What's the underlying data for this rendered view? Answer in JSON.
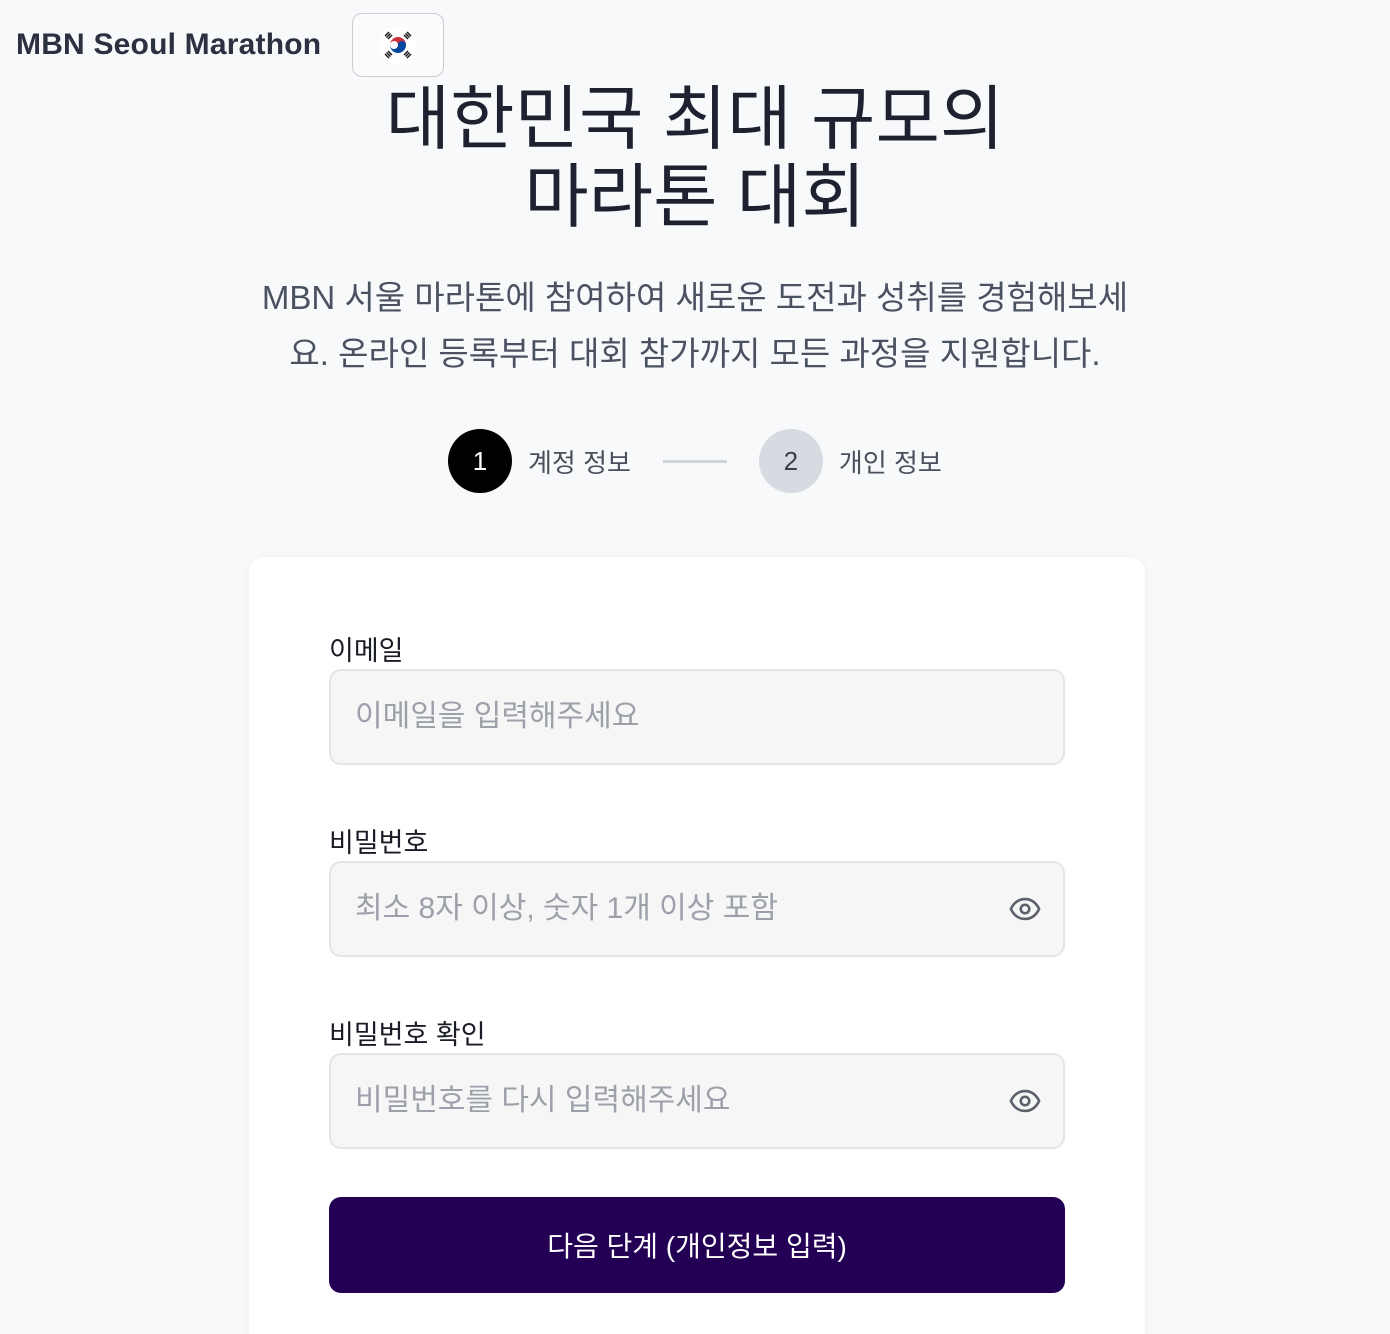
{
  "header": {
    "brand": "MBN Seoul Marathon",
    "language_icon": "south-korea-flag-icon"
  },
  "hero": {
    "title_line1": "대한민국 최대 규모의",
    "title_line2": "마라톤 대회",
    "subtitle": "MBN 서울 마라톤에 참여하여 새로운 도전과 성취를 경험해보세요. 온라인 등록부터 대회 참가까지 모든 과정을 지원합니다."
  },
  "stepper": {
    "steps": [
      {
        "number": "1",
        "label": "계정 정보",
        "active": true
      },
      {
        "number": "2",
        "label": "개인 정보",
        "active": false
      }
    ]
  },
  "form": {
    "email": {
      "label": "이메일",
      "value": "",
      "placeholder": "이메일을 입력해주세요"
    },
    "password": {
      "label": "비밀번호",
      "value": "",
      "placeholder": "최소 8자 이상, 숫자 1개 이상 포함",
      "toggle_icon": "eye-icon"
    },
    "password_confirm": {
      "label": "비밀번호 확인",
      "value": "",
      "placeholder": "비밀번호를 다시 입력해주세요",
      "toggle_icon": "eye-icon"
    },
    "submit_label": "다음 단계 (개인정보 입력)"
  },
  "colors": {
    "background": "#f8f9fb",
    "primary_button": "#240055",
    "active_step": "#000000",
    "inactive_step": "#d7dae0"
  }
}
